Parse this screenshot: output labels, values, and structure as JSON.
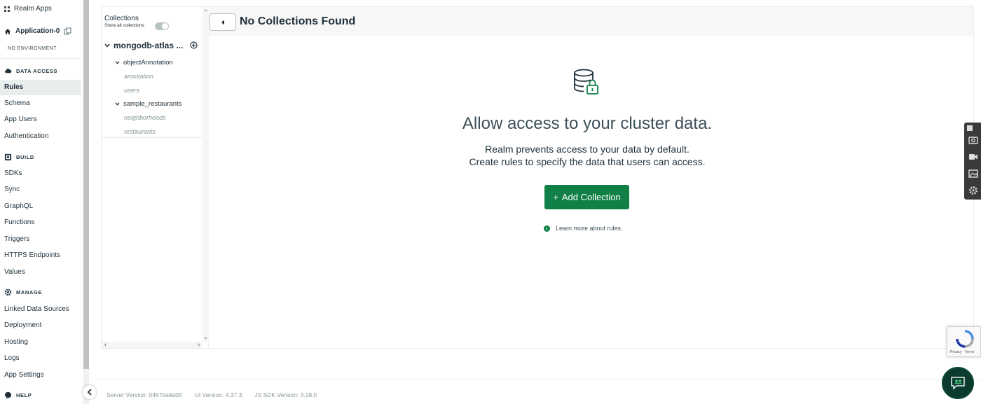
{
  "sidebar": {
    "realm_apps": "Realm Apps",
    "app_name": "Application-0",
    "environment": "NO ENVIRONMENT",
    "sections": [
      {
        "title": "DATA ACCESS",
        "icon": "cloud-icon",
        "items": [
          "Rules",
          "Schema",
          "App Users",
          "Authentication"
        ]
      },
      {
        "title": "BUILD",
        "icon": "build-icon",
        "items": [
          "SDKs",
          "Sync",
          "GraphQL",
          "Functions",
          "Triggers",
          "HTTPS Endpoints",
          "Values"
        ]
      },
      {
        "title": "MANAGE",
        "icon": "gear-icon",
        "items": [
          "Linked Data Sources",
          "Deployment",
          "Hosting",
          "Logs",
          "App Settings"
        ]
      },
      {
        "title": "HELP",
        "icon": "help-icon",
        "items": []
      }
    ],
    "active_item": "Rules"
  },
  "tree": {
    "title": "Collections",
    "show_all_label": "Show all collections",
    "show_all_enabled": true,
    "data_source": "mongodb-atlas ...",
    "databases": [
      {
        "name": "objectAnnotation",
        "collections": [
          "annotation",
          "users"
        ]
      },
      {
        "name": "sample_restaurants",
        "collections": [
          "neighborhoods",
          "restaurants"
        ]
      }
    ]
  },
  "main": {
    "title": "No Collections Found",
    "hero_title": "Allow access to your cluster data.",
    "hero_line1": "Realm prevents access to your data by default.",
    "hero_line2": "Create rules to specify the data that users can access.",
    "add_button": "Add Collection",
    "add_button_prefix": "+",
    "learn_more": "Learn more about rules."
  },
  "footer": {
    "server_version": "Server Version: 0467ba8a00",
    "ui_version": "UI Version: 4.37.3",
    "sdk_version": "JS SDK Version: 3.18.0"
  },
  "widgets": {
    "recaptcha_text": "Privacy - Terms"
  },
  "colors": {
    "accent_green": "#108046",
    "active_bg": "#e7eeec",
    "text_dark": "#21313c",
    "text_muted": "#89979b"
  }
}
